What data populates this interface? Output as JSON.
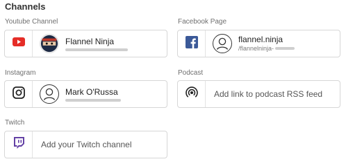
{
  "section": {
    "title": "Channels"
  },
  "youtube": {
    "label": "Youtube Channel",
    "name": "Flannel Ninja",
    "icon": "youtube-icon",
    "color": "#e52d27"
  },
  "facebook": {
    "label": "Facebook Page",
    "name": "flannel.ninja",
    "handle": "/flannelninja-",
    "icon": "facebook-icon",
    "color": "#3b5998"
  },
  "instagram": {
    "label": "Instagram",
    "name": "Mark O'Russa",
    "icon": "instagram-icon"
  },
  "podcast": {
    "label": "Podcast",
    "placeholder": "Add link to podcast RSS feed",
    "icon": "podcast-icon"
  },
  "twitch": {
    "label": "Twitch",
    "placeholder": "Add your Twitch channel",
    "icon": "twitch-icon",
    "color": "#6441a5"
  }
}
